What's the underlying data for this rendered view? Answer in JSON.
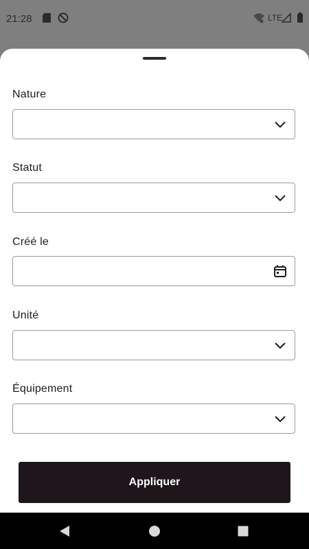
{
  "status_bar": {
    "time": "21:28",
    "network": "LTE"
  },
  "form": {
    "fields": [
      {
        "label": "Nature",
        "value": "",
        "icon": "chevron-down-icon"
      },
      {
        "label": "Statut",
        "value": "",
        "icon": "chevron-down-icon"
      },
      {
        "label": "Créé le",
        "value": "",
        "icon": "calendar-icon"
      },
      {
        "label": "Unité",
        "value": "",
        "icon": "chevron-down-icon"
      },
      {
        "label": "Équipement",
        "value": "",
        "icon": "chevron-down-icon"
      }
    ],
    "apply_label": "Appliquer"
  },
  "colors": {
    "primary_button": "#1e161a",
    "border": "#9b9b9b",
    "scrim": "#7f7f7f"
  }
}
